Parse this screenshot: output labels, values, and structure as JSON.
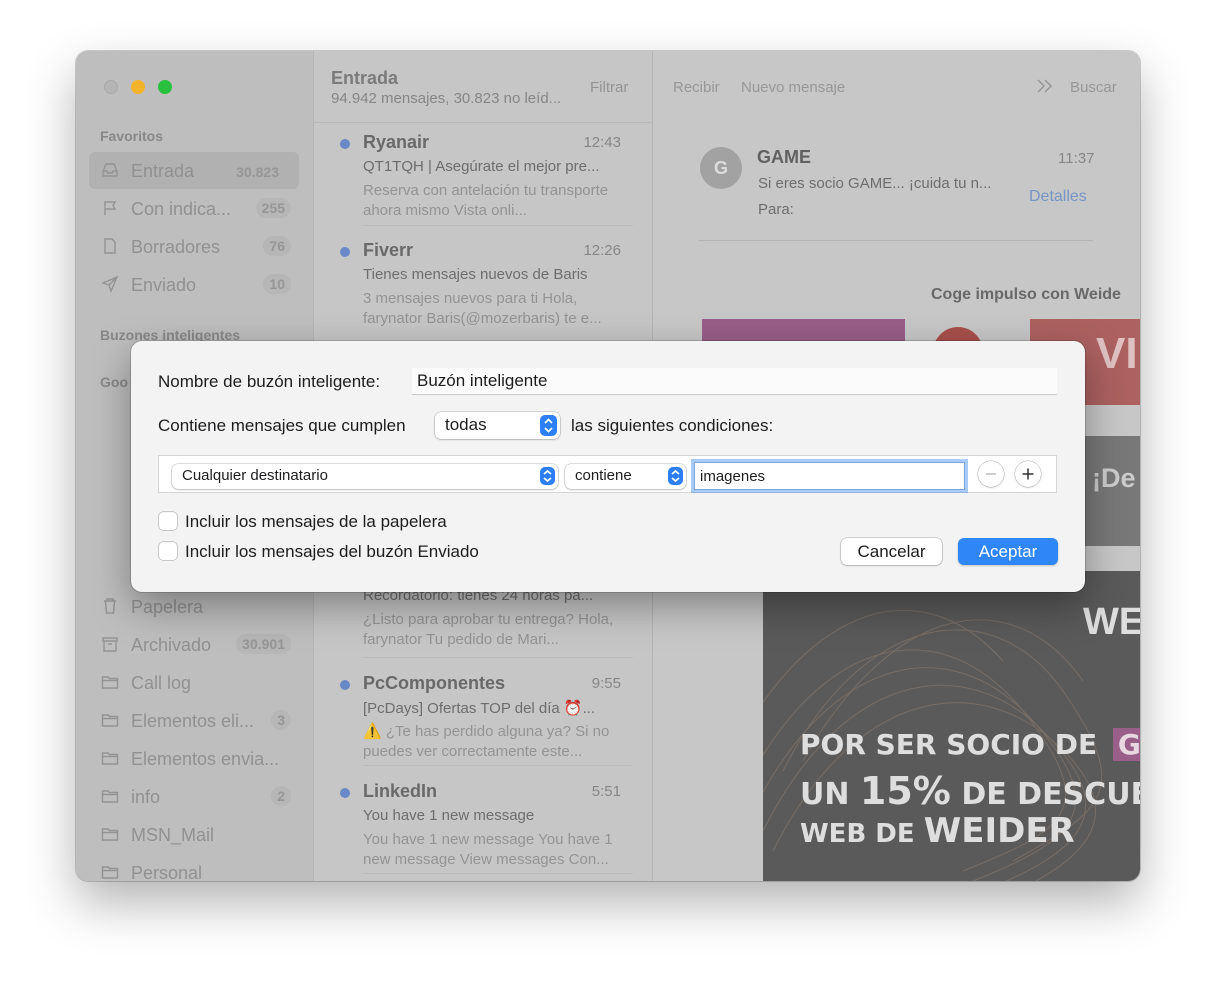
{
  "sidebar": {
    "favorites_label": "Favoritos",
    "smart_label": "Buzones inteligentes",
    "google_label": "Goo",
    "favorites": [
      {
        "label": "Entrada",
        "count": "30.823",
        "icon": "tray-icon"
      },
      {
        "label": "Con indica...",
        "count": "255",
        "icon": "flag-icon"
      },
      {
        "label": "Borradores",
        "count": "76",
        "icon": "document-icon"
      },
      {
        "label": "Enviado",
        "count": "10",
        "icon": "paper-plane-icon"
      }
    ],
    "folders": [
      {
        "label": "Papelera",
        "count": "",
        "icon": "trash-icon"
      },
      {
        "label": "Archivado",
        "count": "30.901",
        "icon": "archive-box-icon"
      },
      {
        "label": "Call log",
        "count": "",
        "icon": "folder-icon"
      },
      {
        "label": "Elementos eli...",
        "count": "3",
        "icon": "folder-icon"
      },
      {
        "label": "Elementos envia...",
        "count": "",
        "icon": "folder-icon"
      },
      {
        "label": "info",
        "count": "2",
        "icon": "folder-icon"
      },
      {
        "label": "MSN_Mail",
        "count": "",
        "icon": "folder-icon"
      },
      {
        "label": "Personal",
        "count": "",
        "icon": "folder-icon"
      }
    ]
  },
  "list": {
    "title": "Entrada",
    "subtitle": "94.942 mensajes, 30.823 no leíd...",
    "filter": "Filtrar",
    "messages": [
      {
        "sender": "Ryanair",
        "time": "12:43",
        "subject": "QT1TQH | Asegúrate el mejor pre...",
        "preview": "Reserva con antelación tu transporte ahora mismo Vista onli..."
      },
      {
        "sender": "Fiverr",
        "time": "12:26",
        "subject": "Tienes mensajes nuevos de Baris",
        "preview": "3 mensajes nuevos para ti Hola, farynator Baris(@mozerbaris) te e..."
      },
      {
        "sender": "",
        "time": "",
        "subject": "Recordatorio: tienes 24 horas pa...",
        "preview": "¿Listo para aprobar tu entrega? Hola, farynator Tu pedido de Mari..."
      },
      {
        "sender": "PcComponentes",
        "time": "9:55",
        "subject": "[PcDays] Ofertas TOP del día ⏰...",
        "preview": "⚠️ ¿Te has perdido alguna ya? Si no puedes ver correctamente este..."
      },
      {
        "sender": "LinkedIn",
        "time": "5:51",
        "subject": "You have 1 new message",
        "preview": "You have 1 new message You have 1 new message View messages Con..."
      }
    ]
  },
  "toolbar": {
    "receive": "Recibir",
    "new_message": "Nuevo mensaje",
    "search": "Buscar"
  },
  "reader": {
    "avatar_letter": "G",
    "from": "GAME",
    "time": "11:37",
    "subject": "Si eres socio GAME... ¡cuida tu n...",
    "to_label": "Para:",
    "details": "Detalles",
    "promo_heading": "Coge impulso con Weide",
    "ad_fragment_1": "¡De",
    "ad_fragment_2": "WE",
    "ad_fragment_3": "VI",
    "ad_line1": "POR SER SOCIO DE",
    "ad_line1_badge": "GAM",
    "ad_line2a": "UN",
    "ad_line2b": "15%",
    "ad_line2c": "DE DESCUENTO",
    "ad_line3a": "WEB DE",
    "ad_line3b": "WEIDER"
  },
  "dialog": {
    "name_label": "Nombre de buzón inteligente:",
    "name_value": "Buzón inteligente",
    "contains_label": "Contiene mensajes que cumplen",
    "match_value": "todas",
    "conditions_label": "las siguientes condiciones:",
    "rule_field": "Cualquier destinatario",
    "rule_operator": "contiene",
    "rule_value": "imagenes",
    "include_trash": "Incluir los mensajes de la papelera",
    "include_sent": "Incluir los mensajes del buzón Enviado",
    "cancel": "Cancelar",
    "accept": "Aceptar"
  },
  "colors": {
    "accent": "#2f86f6",
    "unread_dot": "#6d8fd0",
    "ad_magenta": "#a0638f"
  }
}
